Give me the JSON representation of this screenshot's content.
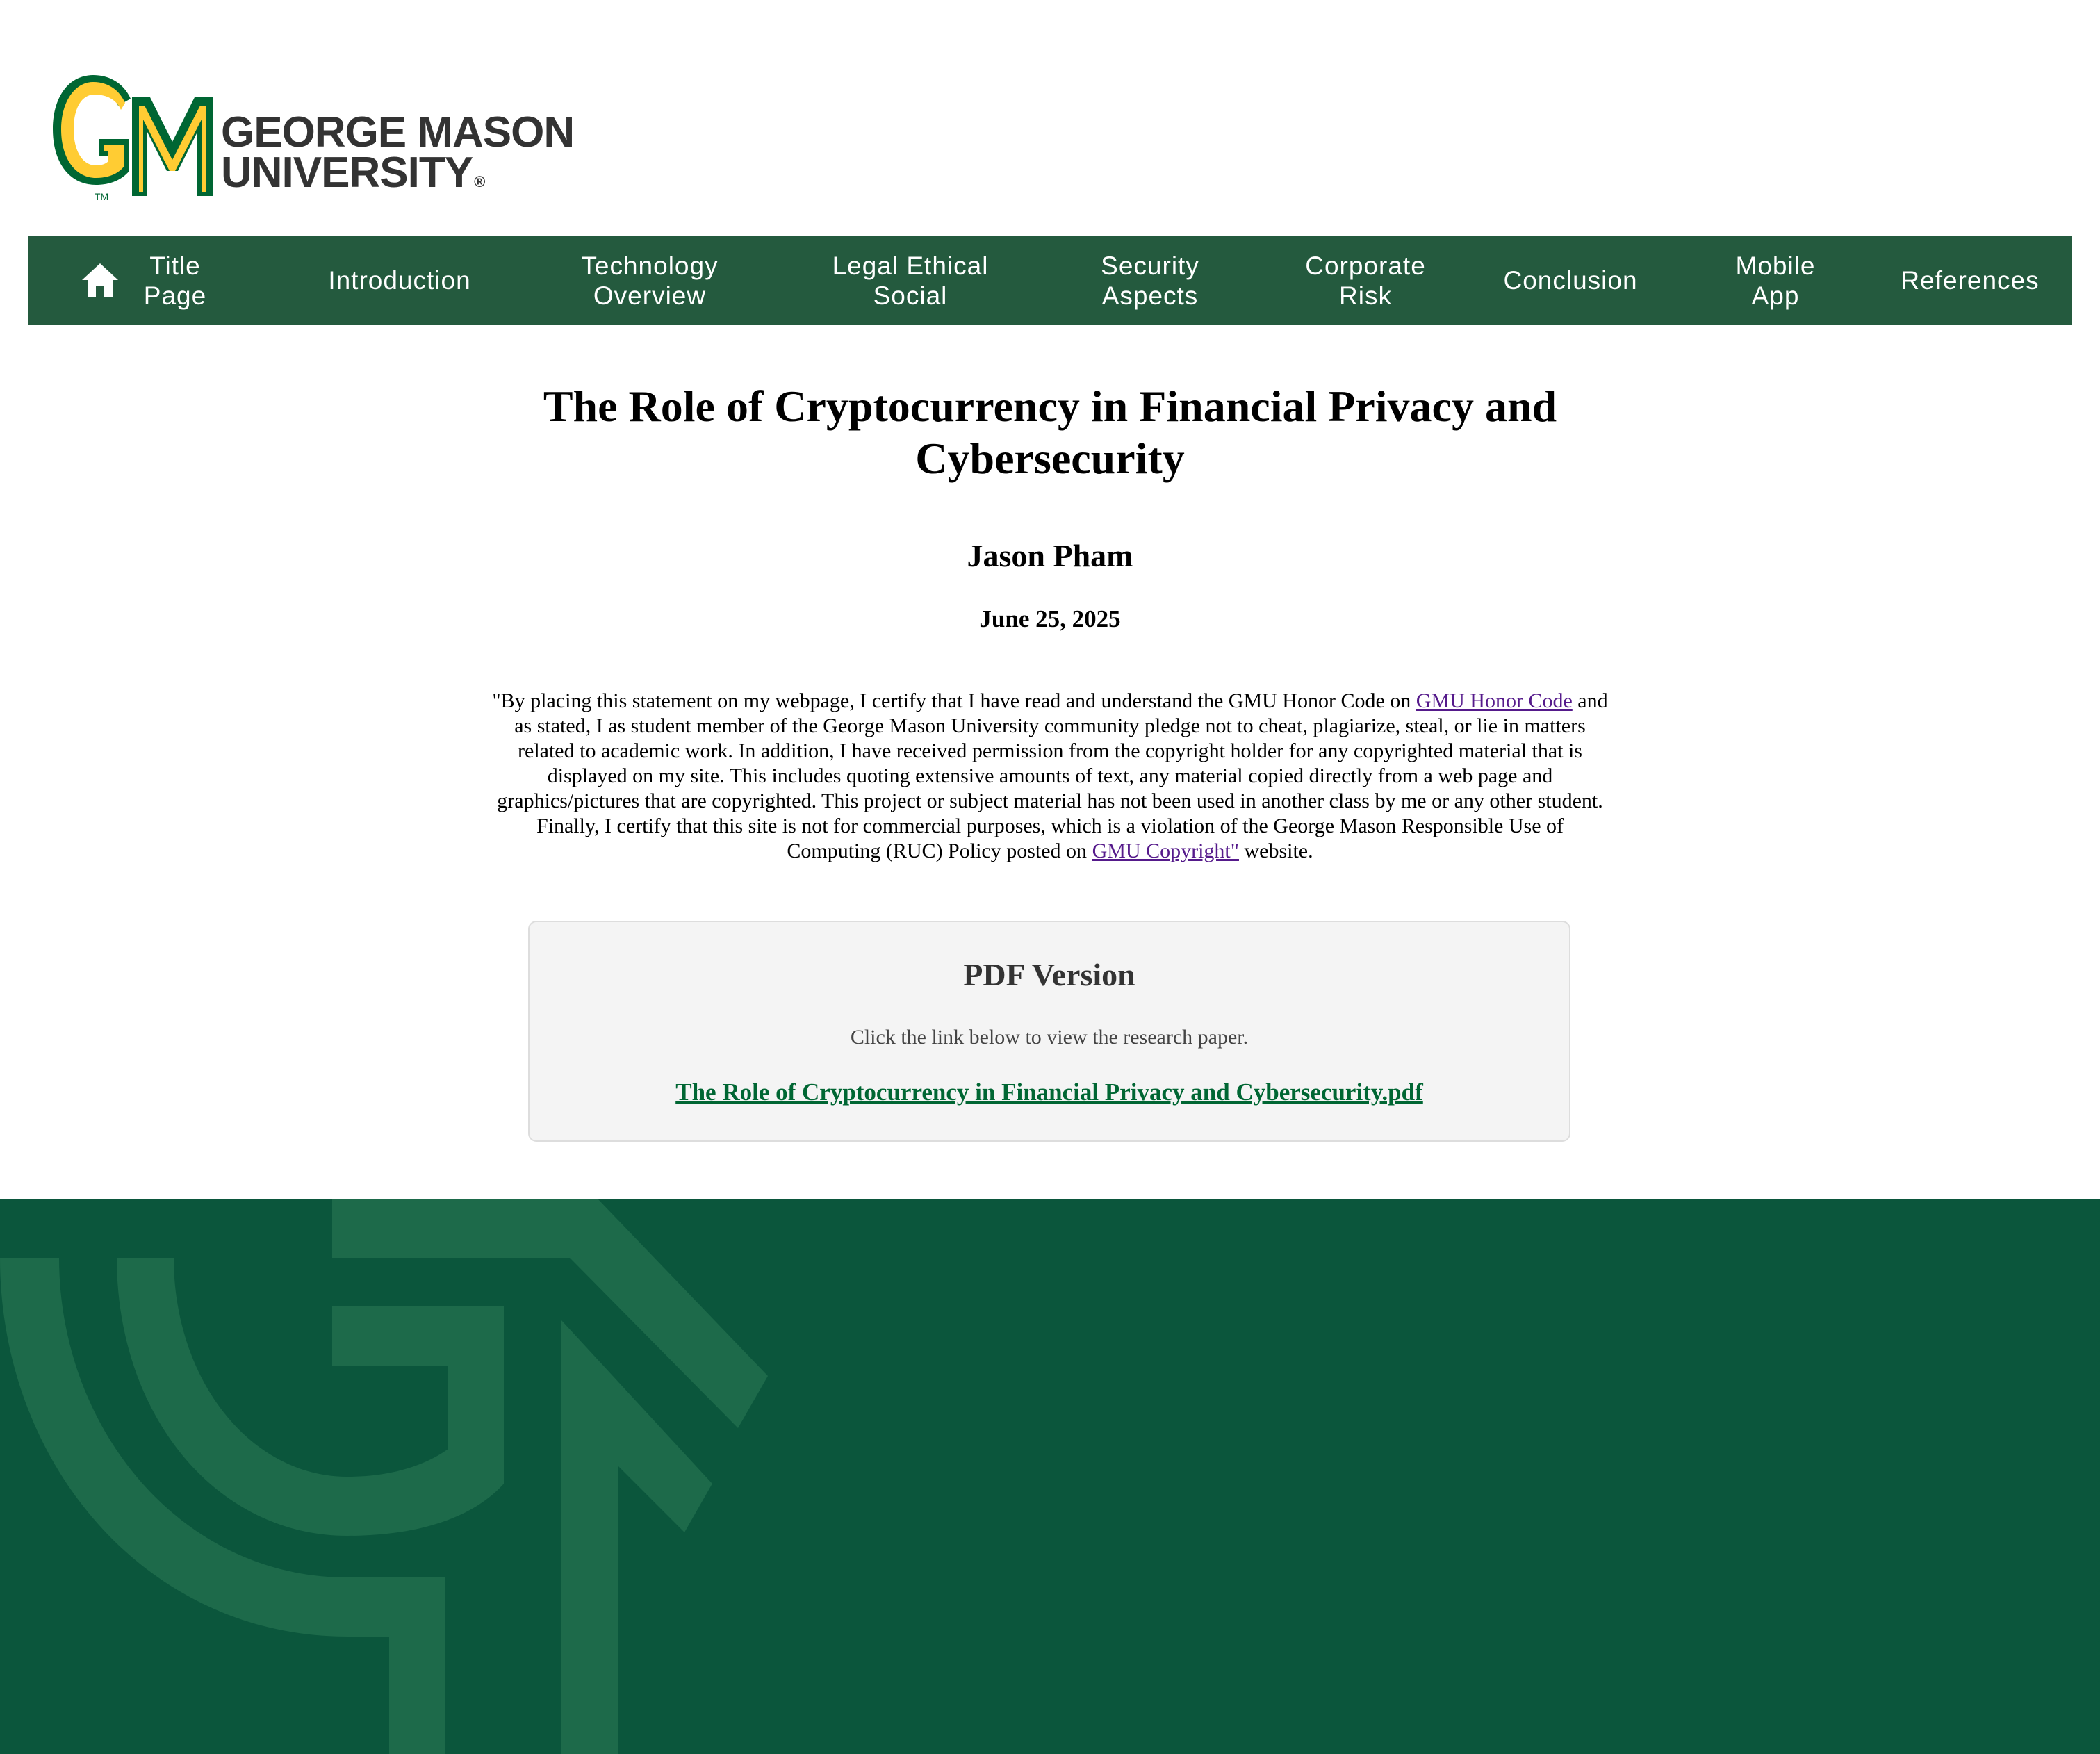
{
  "header": {
    "logo": {
      "name_line1": "GEORGE MASON",
      "name_line2": "UNIVERSITY",
      "registered_mark": "®",
      "trademark": "TM",
      "colors": {
        "green": "#006633",
        "gold": "#ffcc33",
        "text": "#333333"
      }
    }
  },
  "nav": {
    "background": "#245a3e",
    "home_icon": "home-icon",
    "items": [
      {
        "label": "Title\nPage"
      },
      {
        "label": "Introduction"
      },
      {
        "label": "Technology\nOverview"
      },
      {
        "label": "Legal Ethical\nSocial"
      },
      {
        "label": "Security\nAspects"
      },
      {
        "label": "Corporate\nRisk"
      },
      {
        "label": "Conclusion"
      },
      {
        "label": "Mobile\nApp"
      },
      {
        "label": "References"
      }
    ]
  },
  "main": {
    "title": "The Role of Cryptocurrency in Financial Privacy and Cybersecurity",
    "author": "Jason Pham",
    "date": "June 25, 2025",
    "statement": {
      "part1": "\"By placing this statement on my webpage, I certify that I have read and understand the GMU Honor Code on ",
      "link1": "GMU Honor Code",
      "part2": " and as stated, I as student member of the George Mason University community pledge not to cheat, plagiarize, steal, or lie in matters related to academic work. In addition, I have received permission from the copyright holder for any copyrighted material that is displayed on my site. This includes quoting extensive amounts of text, any material copied directly from a web page and graphics/pictures that are copyrighted. This project or subject material has not been used in another class by me or any other student. Finally, I certify that this site is not for commercial purposes, which is a violation of the George Mason Responsible Use of Computing (RUC) Policy posted on ",
      "link2": "GMU Copyright\"",
      "part3": " website."
    },
    "pdf": {
      "heading": "PDF Version",
      "description": "Click the link below to view the research paper.",
      "link_text": "The Role of Cryptocurrency in Financial Privacy and Cybersecurity.pdf",
      "link_color": "#006633"
    }
  },
  "footer": {
    "background": "#0b563c",
    "watermark_icon": "gm-watermark-icon"
  }
}
